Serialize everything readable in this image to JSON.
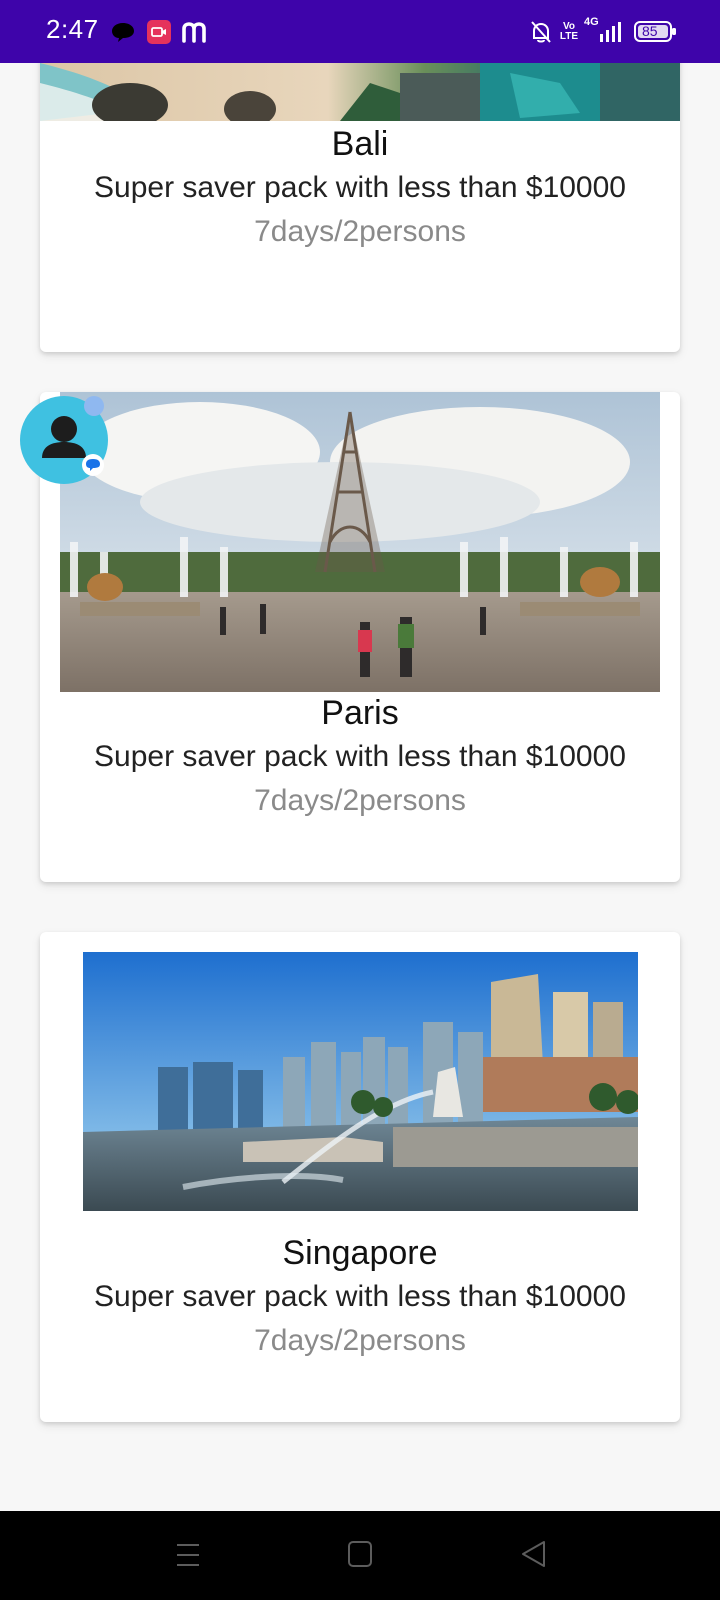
{
  "status_bar": {
    "time": "2:47",
    "battery": "85",
    "network_label": "4G",
    "volte_label": "Vo LTE",
    "icons": [
      "chat-bubble-icon",
      "video-recorder-icon",
      "m-logo-icon",
      "bell-off-icon",
      "volte-icon",
      "signal-icon",
      "battery-icon"
    ]
  },
  "cards": [
    {
      "title": "Bali",
      "description": "Super saver pack with less than $10000",
      "meta": "7days/2persons",
      "image_alt": "beach-coastline-photo"
    },
    {
      "title": "Paris",
      "description": "Super saver pack with less than $10000",
      "meta": "7days/2persons",
      "image_alt": "eiffel-tower-photo"
    },
    {
      "title": "Singapore",
      "description": "Super saver pack with less than $10000",
      "meta": "7days/2persons",
      "image_alt": "marina-bay-skyline-photo"
    }
  ],
  "floating_bubble": {
    "icon": "person-avatar-icon",
    "badge": "chat-badge-icon"
  },
  "nav_bar": {
    "buttons": [
      "menu-icon",
      "home-icon",
      "back-icon"
    ]
  },
  "colors": {
    "status_bar": "#3e04aa",
    "accent_bubble": "#3fc1e1",
    "meta_text": "#8a8a8a"
  }
}
